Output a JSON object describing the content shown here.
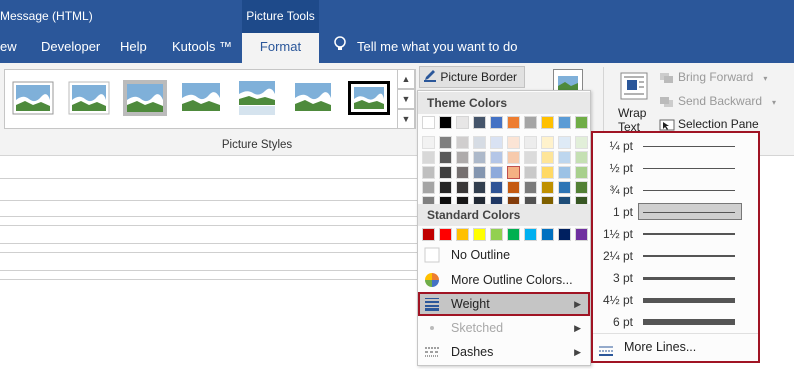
{
  "window": {
    "title": "Message (HTML)",
    "context_tab": "Picture Tools"
  },
  "tabs": [
    {
      "label": "ew"
    },
    {
      "label": "Developer"
    },
    {
      "label": "Help"
    },
    {
      "label": "Kutools ™"
    },
    {
      "label": "Format",
      "active": true
    }
  ],
  "tell_me": "Tell me what you want to do",
  "ribbon": {
    "picture_styles_label": "Picture Styles",
    "picture_border_label": "Picture Border",
    "wrap_text_label_1": "Wrap",
    "wrap_text_label_2": "Text",
    "bring_forward": "Bring Forward",
    "send_backward": "Send Backward",
    "selection_pane": "Selection Pane"
  },
  "border_menu": {
    "theme_colors_header": "Theme Colors",
    "standard_colors_header": "Standard Colors",
    "theme_colors_top": [
      "#ffffff",
      "#000000",
      "#e7e6e6",
      "#44546a",
      "#4472c4",
      "#ed7d31",
      "#a5a5a5",
      "#ffc000",
      "#5b9bd5",
      "#70ad47"
    ],
    "theme_tints": [
      [
        "#f2f2f2",
        "#7f7f7f",
        "#d0cece",
        "#d6dce4",
        "#d9e2f3",
        "#fbe4d5",
        "#ededed",
        "#fff2cc",
        "#deeaf6",
        "#e2efd9"
      ],
      [
        "#d8d8d8",
        "#595959",
        "#aeabab",
        "#adb9ca",
        "#b4c6e7",
        "#f7caac",
        "#dbdbdb",
        "#fee599",
        "#bdd6ee",
        "#c5e0b3"
      ],
      [
        "#bfbfbf",
        "#3f3f3f",
        "#757070",
        "#8496b0",
        "#8eaadb",
        "#f4b183",
        "#c9c9c9",
        "#ffd965",
        "#9cc2e5",
        "#a8d08d"
      ],
      [
        "#a5a5a5",
        "#262626",
        "#3a3838",
        "#323f4f",
        "#2f5496",
        "#c55a11",
        "#7b7b7b",
        "#bf9000",
        "#2e75b5",
        "#538135"
      ],
      [
        "#7f7f7f",
        "#0c0c0c",
        "#171616",
        "#222a35",
        "#1f3864",
        "#833c0b",
        "#525252",
        "#7f6000",
        "#1e4d78",
        "#375623"
      ]
    ],
    "standard_colors": [
      "#c00000",
      "#ff0000",
      "#ffc000",
      "#ffff00",
      "#92d050",
      "#00b050",
      "#00b0f0",
      "#0070c0",
      "#002060",
      "#7030a0"
    ],
    "no_outline": "No Outline",
    "more_outline_colors": "More Outline Colors...",
    "weight": "Weight",
    "sketched": "Sketched",
    "dashes": "Dashes"
  },
  "weight_menu": {
    "options": [
      {
        "label": "¼ pt",
        "pt": 0.25
      },
      {
        "label": "½ pt",
        "pt": 0.5
      },
      {
        "label": "¾ pt",
        "pt": 0.75
      },
      {
        "label": "1 pt",
        "pt": 1,
        "selected": true
      },
      {
        "label": "1½ pt",
        "pt": 1.5
      },
      {
        "label": "2¼ pt",
        "pt": 2.25
      },
      {
        "label": "3 pt",
        "pt": 3
      },
      {
        "label": "4½ pt",
        "pt": 4.5
      },
      {
        "label": "6 pt",
        "pt": 6
      }
    ],
    "more_lines": "More Lines..."
  },
  "colors": {
    "ribbon_blue": "#2b579a",
    "highlight_outline": "#a01424"
  }
}
